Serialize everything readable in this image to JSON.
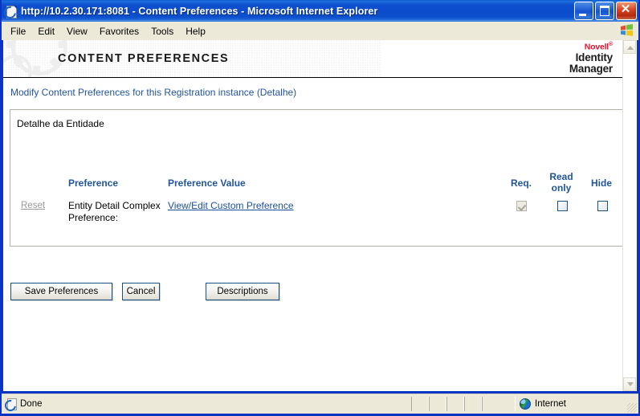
{
  "window": {
    "title": "http://10.2.30.171:8081 - Content Preferences - Microsoft Internet Explorer",
    "minimize_label": "_",
    "maximize_label": "□",
    "close_label": "✕"
  },
  "menubar": {
    "items": [
      {
        "label": "File"
      },
      {
        "label": "Edit"
      },
      {
        "label": "View"
      },
      {
        "label": "Favorites"
      },
      {
        "label": "Tools"
      },
      {
        "label": "Help"
      }
    ]
  },
  "banner": {
    "title": "CONTENT PREFERENCES",
    "brand_name": "Novell",
    "brand_mark": "®",
    "product_line1": "Identity",
    "product_line2": "Manager"
  },
  "page": {
    "subtitle": "Modify Content Preferences for this Registration instance (Detalhe)",
    "panel_heading": "Detalhe da Entidade"
  },
  "table": {
    "headers": {
      "preference": "Preference",
      "preference_value": "Preference Value",
      "req": "Req.",
      "read_only_line1": "Read",
      "read_only_line2": "only",
      "hide": "Hide"
    },
    "rows": [
      {
        "reset_label": "Reset",
        "reset_enabled": false,
        "preference": "Entity Detail Complex Preference:",
        "value_link": "View/Edit Custom Preference",
        "req_checked": true,
        "req_enabled": false,
        "read_only_checked": false,
        "read_only_enabled": true,
        "hide_checked": false,
        "hide_enabled": true
      }
    ]
  },
  "buttons": {
    "save": "Save Preferences",
    "cancel": "Cancel",
    "descriptions": "Descriptions"
  },
  "statusbar": {
    "status_text": "Done",
    "zone_text": "Internet"
  },
  "colors": {
    "titlebar_blue": "#0b4ccc",
    "heading_blue": "#22559b",
    "link_blue": "#1a4f9c",
    "novell_red": "#e8112d",
    "disabled_gray": "#9a9a9a",
    "chrome_beige": "#ece9d8"
  }
}
